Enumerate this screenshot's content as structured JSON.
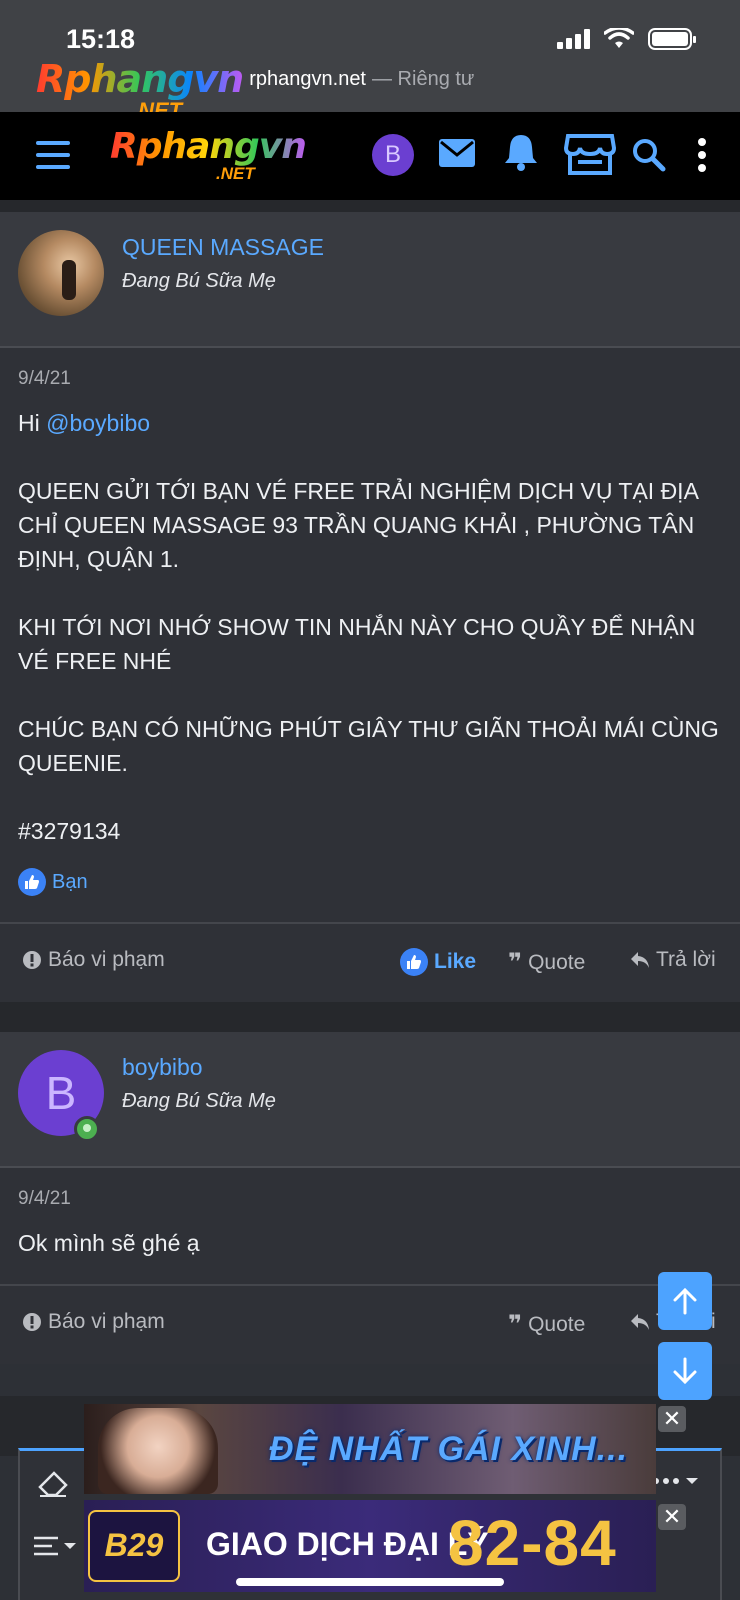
{
  "status_bar": {
    "time": "15:18"
  },
  "browser": {
    "logo_text": "Rphangvn",
    "logo_suffix": ".NET",
    "domain": "rphangvn.net",
    "separator": "— Riêng tư"
  },
  "navbar": {
    "logo_text": "Rphangvn",
    "logo_suffix": ".NET",
    "avatar_letter": "B",
    "icons": [
      "menu-icon",
      "mail-icon",
      "bell-icon",
      "store-icon",
      "search-icon",
      "more-vertical-icon"
    ],
    "accent": "#5aa9ff"
  },
  "posts": [
    {
      "username": "QUEEN MASSAGE",
      "user_title": "Đang Bú Sữa Mẹ",
      "date": "9/4/21",
      "greeting": "Hi ",
      "mention": "@boybibo",
      "paragraphs": [
        "QUEEN GỬI TỚI BẠN VÉ FREE TRẢI NGHIỆM DỊCH VỤ TẠI ĐỊA CHỈ QUEEN MASSAGE 93 TRẦN QUANG KHẢI , PHƯỜNG TÂN ĐỊNH, QUẬN 1.",
        "KHI TỚI NƠI NHỚ SHOW TIN NHẮN NÀY CHO QUẦY ĐỂ NHẬN VÉ FREE NHÉ",
        "CHÚC BẠN CÓ NHỮNG PHÚT GIÂY THƯ GIÃN THOẢI MÁI CÙNG QUEENIE.",
        "#3279134"
      ],
      "reaction_label": "Bạn",
      "actions": {
        "report": "Báo vi phạm",
        "like": "Like",
        "quote": "Quote",
        "reply": "Trả lời"
      }
    },
    {
      "username": "boybibo",
      "avatar_letter": "B",
      "user_title": "Đang Bú Sữa Mẹ",
      "date": "9/4/21",
      "text": "Ok mình sẽ ghé ạ",
      "actions": {
        "report": "Báo vi phạm",
        "quote": "Quote",
        "reply": "Trả lời"
      }
    }
  ],
  "ads": {
    "banner1_text": "ĐỆ NHẤT GÁI XINH...",
    "banner2_logo": "B29",
    "banner2_text": "GIAO DỊCH ĐẠI LÝ",
    "banner2_number": "82-84",
    "close_label": "✕"
  }
}
